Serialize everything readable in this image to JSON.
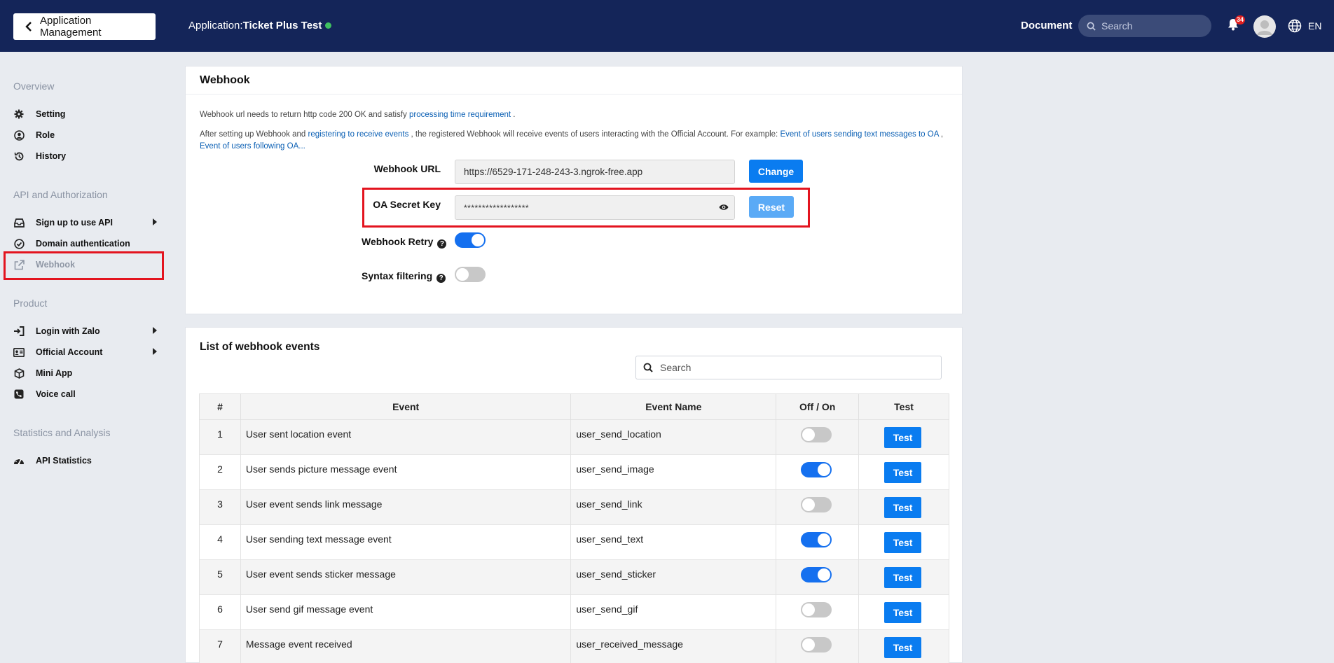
{
  "header": {
    "back_label": "Application Management",
    "app_prefix": "Application:",
    "app_name": "Ticket Plus Test",
    "document_label": "Document",
    "search_placeholder": "Search",
    "notification_count": "34",
    "language": "EN"
  },
  "sidebar": {
    "sections": [
      {
        "title": "Overview",
        "items": [
          {
            "label": "Setting",
            "icon": "gear-icon"
          },
          {
            "label": "Role",
            "icon": "user-circle-icon"
          },
          {
            "label": "History",
            "icon": "history-icon"
          }
        ]
      },
      {
        "title": "API and Authorization",
        "items": [
          {
            "label": "Sign up to use API",
            "icon": "inbox-icon",
            "submenu": true
          },
          {
            "label": "Domain authentication",
            "icon": "check-circle-icon"
          },
          {
            "label": "Webhook",
            "icon": "external-link-icon",
            "active": true
          }
        ]
      },
      {
        "title": "Product",
        "items": [
          {
            "label": "Login with Zalo",
            "icon": "sign-in-icon",
            "submenu": true
          },
          {
            "label": "Official Account",
            "icon": "id-card-icon",
            "submenu": true
          },
          {
            "label": "Mini App",
            "icon": "cube-icon"
          },
          {
            "label": "Voice call",
            "icon": "phone-icon"
          }
        ]
      },
      {
        "title": "Statistics and Analysis",
        "items": [
          {
            "label": "API Statistics",
            "icon": "dashboard-icon"
          }
        ]
      }
    ]
  },
  "webhook": {
    "title": "Webhook",
    "line1_text": "Webhook url needs to return http code 200 OK and satisfy ",
    "line1_link": "processing time requirement",
    "line1_end": " .",
    "line2_text": "After setting up Webhook and ",
    "line2_link1": "registering to receive events",
    "line2_mid": " , the registered Webhook will receive events of users interacting with the Official Account. For example: ",
    "line2_link2": "Event of users sending text messages to OA",
    "line2_sep": " , ",
    "line2_link3": "Event of users following OA...",
    "url_label": "Webhook URL",
    "url_value": "https://6529-171-248-243-3.ngrok-free.app",
    "change_label": "Change",
    "secret_label": "OA Secret Key",
    "secret_value": "******************",
    "reset_label": "Reset",
    "retry_label": "Webhook Retry",
    "retry_on": true,
    "syntax_label": "Syntax filtering",
    "syntax_on": false
  },
  "events": {
    "title": "List of webhook events",
    "search_placeholder": "Search",
    "columns": [
      "#",
      "Event",
      "Event Name",
      "Off / On",
      "Test"
    ],
    "test_label": "Test",
    "rows": [
      {
        "num": "1",
        "event": "User sent location event",
        "name": "user_send_location",
        "on": false
      },
      {
        "num": "2",
        "event": "User sends picture message event",
        "name": "user_send_image",
        "on": true
      },
      {
        "num": "3",
        "event": "User event sends link message",
        "name": "user_send_link",
        "on": false
      },
      {
        "num": "4",
        "event": "User sending text message event",
        "name": "user_send_text",
        "on": true
      },
      {
        "num": "5",
        "event": "User event sends sticker message",
        "name": "user_send_sticker",
        "on": true
      },
      {
        "num": "6",
        "event": "User send gif message event",
        "name": "user_send_gif",
        "on": false
      },
      {
        "num": "7",
        "event": "Message event received",
        "name": "user_received_message",
        "on": false
      }
    ]
  },
  "colors": {
    "header_bg": "#142559",
    "primary_button": "#0a7cf0",
    "highlight_box": "#e3141f",
    "toggle_on": "#1570ef"
  }
}
